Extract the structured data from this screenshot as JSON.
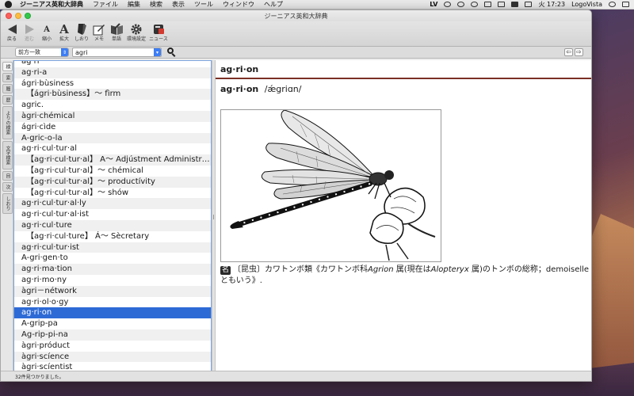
{
  "menubar": {
    "app_name": "ジーニアス英和大辞典",
    "items": [
      "ファイル",
      "編集",
      "検索",
      "表示",
      "ツール",
      "ウィンドウ",
      "ヘルプ"
    ],
    "status_lv": "LV",
    "clock": "火 17:23",
    "account": "LogoVista"
  },
  "window": {
    "title": "ジーニアス英和大辞典"
  },
  "toolbar": {
    "back": "戻る",
    "forward": "進む",
    "shrink": "縮小",
    "enlarge": "拡大",
    "bookmark": "しおり",
    "memo": "メモ",
    "wordbook": "単語",
    "settings": "環境設定",
    "news": "ニュース"
  },
  "search": {
    "mode": "前方一致",
    "query": "agri"
  },
  "sidetabs": [
    "検",
    "索",
    "履",
    "歴",
    "よりの検索",
    "文字検索",
    "目",
    "次",
    "しおり"
  ],
  "word_list": [
    {
      "text": "ag·ri",
      "sub": false
    },
    {
      "text": "ag·ri-a",
      "sub": false
    },
    {
      "text": "ágri·bùsiness",
      "sub": false
    },
    {
      "text": "【ágri·bùsiness】～ fìrm",
      "sub": true
    },
    {
      "text": "agric.",
      "sub": false
    },
    {
      "text": "àgri·chémical",
      "sub": false
    },
    {
      "text": "ágri·cìde",
      "sub": false
    },
    {
      "text": "A-gric-o-la",
      "sub": false
    },
    {
      "text": "ag·ri·cul·tur·al",
      "sub": false
    },
    {
      "text": "【ag·ri·cul·tur·al】 A～ Adjústment Administr…",
      "sub": true
    },
    {
      "text": "【ag·ri·cul·tur·al】～ chémical",
      "sub": true
    },
    {
      "text": "【ag·ri·cul·tur·al】～ productívity",
      "sub": true
    },
    {
      "text": "【ag·ri·cul·tur·al】～ shów",
      "sub": true
    },
    {
      "text": "ag·ri·cul·tur·al·ly",
      "sub": false
    },
    {
      "text": "ag·ri·cul·tur·al·ist",
      "sub": false
    },
    {
      "text": "ag·ri·cul·ture",
      "sub": false
    },
    {
      "text": "【ag·ri·cul·ture】 Á～ Sècretary",
      "sub": true
    },
    {
      "text": "ag·ri·cul·tur·ist",
      "sub": false
    },
    {
      "text": "A-gri·gen·to",
      "sub": false
    },
    {
      "text": "ag·ri·ma·tion",
      "sub": false
    },
    {
      "text": "ag·ri·mo·ny",
      "sub": false
    },
    {
      "text": "àgri－nétwork",
      "sub": false
    },
    {
      "text": "ag·ri·ol·o·gy",
      "sub": false
    },
    {
      "text": "ag·ri·on",
      "sub": false,
      "selected": true
    },
    {
      "text": "A-grip-pa",
      "sub": false
    },
    {
      "text": "Ag-rip-pi-na",
      "sub": false
    },
    {
      "text": "àgri·próduct",
      "sub": false
    },
    {
      "text": "àgri·scíence",
      "sub": false
    },
    {
      "text": "àgri·scíentist",
      "sub": false
    }
  ],
  "entry": {
    "header": "ag·ri·on",
    "headword": "ag·ri·on",
    "pronunciation": "/ǽgriɑn/",
    "pos": "名",
    "def_part1": "〔昆虫〕カワトンボ類《カワトンボ科",
    "genus1": "Agrion",
    "def_part2": " 属(現在は",
    "genus2": "Alopteryx",
    "def_part3": " 属)のトンボの総称；demoiselle ともいう》."
  },
  "statusbar": {
    "text": "32件見つかりました。"
  }
}
